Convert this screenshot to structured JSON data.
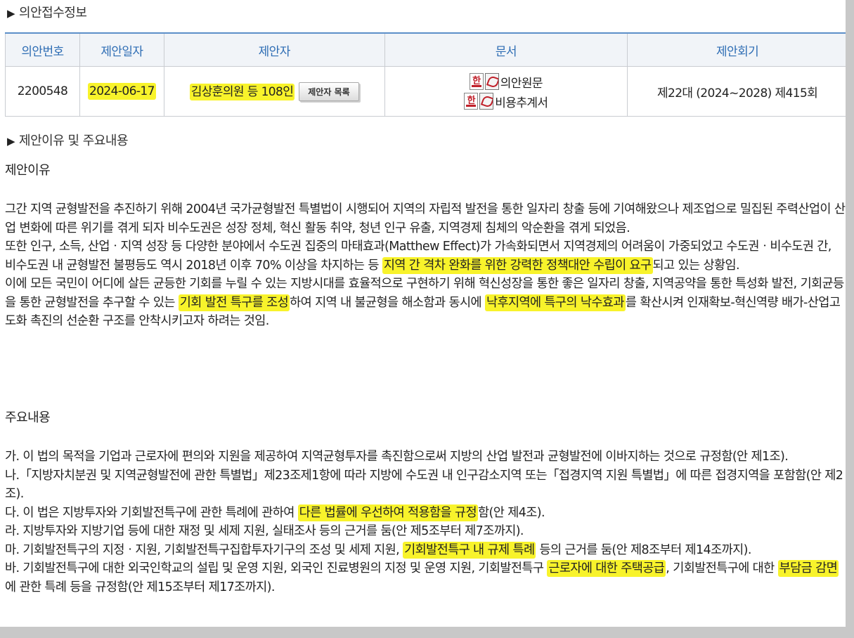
{
  "receipt": {
    "section_title": "의안접수정보",
    "headers": [
      "의안번호",
      "제안일자",
      "제안자",
      "문서",
      "제안회기"
    ],
    "bill_number": "2200548",
    "proposal_date": "2024-06-17",
    "proposer": "김상훈의원 등 108인",
    "proposer_list_button": "제안자 목록",
    "documents": [
      "의안원문",
      "비용추계서"
    ],
    "session": "제22대 (2024~2028) 제415회",
    "icons": [
      "hwp-icon",
      "pdf-icon"
    ],
    "accent_color": "#2e6db4",
    "highlight_color": "#f8f32b"
  },
  "reasons": {
    "section_title": "제안이유 및 주요내용",
    "reason_label": "제안이유",
    "reason_p1": "그간 지역 균형발전을 추진하기 위해 2004년 국가균형발전 특별법이 시행되어 지역의 자립적 발전을 통한 일자리 창출 등에 기여해왔으나 제조업으로 밀집된 주력산업이 산업 변화에 따른 위기를 겪게 되자 비수도권은 성장 정체, 혁신 활동 취약, 청년 인구 유출, 지역경제 침체의 악순환을 겪게 되었음.",
    "reason_p2_a": "또한 인구, 소득, 산업ㆍ지역 성장 등 다양한 분야에서 수도권 집중의 마태효과(Matthew Effect)가 가속화되면서 지역경제의 어려움이 가중되었고 수도권ㆍ비수도권 간, 비수도권 내 균형발전 불평등도 역시 2018년 이후 70% 이상을 차지하는 등 ",
    "reason_p2_hl": "지역 간 격차 완화를 위한 강력한 정책대안 수립이 요구",
    "reason_p2_b": "되고 있는 상황임.",
    "reason_p3_a": "이에 모든 국민이 어디에 살든 균등한 기회를 누릴 수 있는 지방시대를 효율적으로 구현하기 위해 혁신성장을 통한 좋은 일자리 창출, 지역공약을 통한 특성화 발전, 기회균등을 통한 균형발전을 추구할 수 있는 ",
    "reason_p3_hl1": "기회 발전 특구를 조성",
    "reason_p3_b": "하여 지역 내 불균형을 해소함과 동시에 ",
    "reason_p3_hl2": "낙후지역에 특구의 낙수효과",
    "reason_p3_c": "를 확산시켜 인재확보-혁신역량 배가-산업고도화 촉진의 선순환 구조를 안착시키고자 하려는 것임.",
    "main_label": "주요내용",
    "item_ga": "가. 이 법의 목적을 기업과 근로자에 편의와 지원을 제공하여 지역균형투자를 촉진함으로써 지방의 산업 발전과 균형발전에 이바지하는 것으로 규정함(안 제1조).",
    "item_na": "나.「지방자치분권 및 지역균형발전에 관한 특별법」제23조제1항에 따라 지방에 수도권 내 인구감소지역 또는「접경지역 지원 특별법」에 따른 접경지역을 포함함(안 제2조).",
    "item_da_a": "다. 이 법은 지방투자와 기회발전특구에 관한 특례에 관하여 ",
    "item_da_hl": "다른 법률에 우선하여 적용함을 규정",
    "item_da_b": "함(안 제4조).",
    "item_ra": "라. 지방투자와 지방기업 등에 대한 재정 및 세제 지원, 실태조사 등의 근거를 둠(안 제5조부터 제7조까지).",
    "item_ma_a": "마. 기회발전특구의 지정ㆍ지원, 기회발전특구집합투자기구의 조성 및 세제 지원, ",
    "item_ma_hl": "기회발전특구 내 규제 특례",
    "item_ma_b": " 등의 근거를 둠(안 제8조부터 제14조까지).",
    "item_ba_a": "바. 기회발전특구에 대한 외국인학교의 설립 및 운영 지원, 외국인 진료병원의 지정 및 운영 지원, 기회발전특구 ",
    "item_ba_hl1": "근로자에 대한 주택공급",
    "item_ba_b": ", 기회발전특구에 대한 ",
    "item_ba_hl2": "부담금 감면",
    "item_ba_c": "에 관한 특례 등을 규정함(안 제15조부터 제17조까지)."
  }
}
